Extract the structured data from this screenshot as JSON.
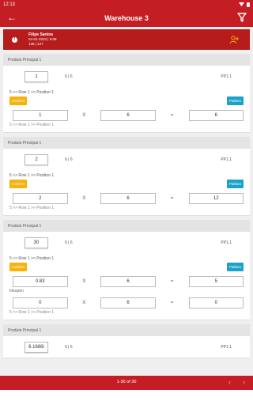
{
  "status_bar": {
    "time": "12:13"
  },
  "app_bar": {
    "title": "Warehouse 3"
  },
  "user": {
    "name": "Filipe Santos",
    "date": "04-01-2022 | 8:08",
    "ids": "136 | 127"
  },
  "blocks": [
    {
      "header": "Produto Principal 1",
      "qty": "1",
      "ratio": "6 | 6",
      "code": "PP1.1",
      "location": "5 >> Row 1 >> Position 1",
      "incident_label": "Incident",
      "pakken_label": "Pakken",
      "calc": {
        "a": "1",
        "x": "X",
        "b": "6",
        "eq": "=",
        "result": "6"
      },
      "sub": "5 >> Row 1 >> Position 1"
    },
    {
      "header": "Produto Principal 1",
      "qty": "2",
      "ratio": "6 | 6",
      "code": "PP1.1",
      "location": "5 >> Row 1 >> Position 1",
      "incident_label": "Incident",
      "pakken_label": "Pakken",
      "calc": {
        "a": "2",
        "x": "X",
        "b": "6",
        "eq": "=",
        "result": "12"
      },
      "sub": "5 >> Row 1 >> Position 1"
    },
    {
      "header": "Produto Principal 1",
      "qty": "30",
      "ratio": "6 | 6",
      "code": "PP1.1",
      "location": "5 >> Row 1 >> Position 1",
      "incident_label": "Incident",
      "pakken_label": "Pakken",
      "calc": {
        "a": "0.83",
        "x": "X",
        "b": "6",
        "eq": "=",
        "result": "5"
      },
      "inkopen": "Inkopen",
      "calc2": {
        "a": "0",
        "x": "X",
        "b": "6",
        "eq": "=",
        "result": "0"
      },
      "sub": "5 >> Row 1 >> Position 1"
    },
    {
      "header": "Produto Principal 1",
      "qty": "6.1666i",
      "ratio": "6 | 6",
      "code": "PP1.1"
    }
  ],
  "pagination": {
    "label": "1-30 of 30",
    "prev": "‹",
    "next": "›"
  }
}
